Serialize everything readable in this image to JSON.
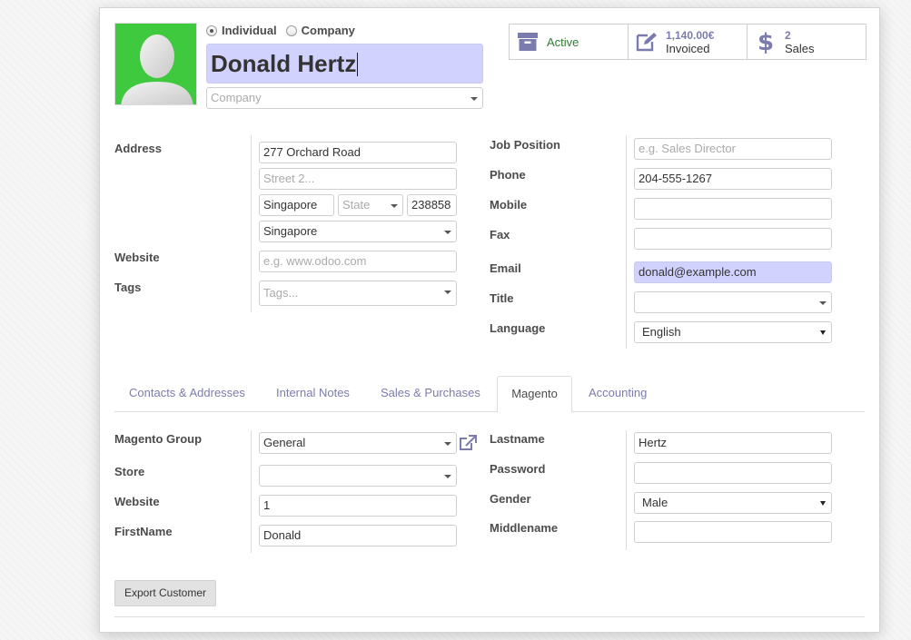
{
  "partner_type": {
    "individual": "Individual",
    "company": "Company"
  },
  "header": {
    "name": "Donald Hertz",
    "company_placeholder": "Company"
  },
  "stats": [
    {
      "label": "Active"
    },
    {
      "value": "1,140.00€",
      "label": "Invoiced"
    },
    {
      "value": "2",
      "label": "Sales"
    }
  ],
  "address": {
    "label": "Address",
    "street": "277 Orchard Road",
    "street2_placeholder": "Street 2...",
    "city": "Singapore",
    "state_placeholder": "State",
    "zip": "238858",
    "country": "Singapore"
  },
  "website": {
    "label": "Website",
    "placeholder": "e.g. www.odoo.com"
  },
  "tags": {
    "label": "Tags",
    "placeholder": "Tags..."
  },
  "right_fields": {
    "job_position": {
      "label": "Job Position",
      "placeholder": "e.g. Sales Director"
    },
    "phone": {
      "label": "Phone",
      "value": "204-555-1267"
    },
    "mobile": {
      "label": "Mobile",
      "value": ""
    },
    "fax": {
      "label": "Fax",
      "value": ""
    },
    "email": {
      "label": "Email",
      "value": "donald@example.com"
    },
    "title": {
      "label": "Title",
      "value": ""
    },
    "language": {
      "label": "Language",
      "value": "English"
    }
  },
  "tabs": [
    "Contacts & Addresses",
    "Internal Notes",
    "Sales & Purchases",
    "Magento",
    "Accounting"
  ],
  "magento": {
    "group": {
      "label": "Magento Group",
      "value": "General"
    },
    "store": {
      "label": "Store",
      "value": ""
    },
    "website": {
      "label": "Website",
      "value": "1"
    },
    "firstname": {
      "label": "FirstName",
      "value": "Donald"
    },
    "lastname": {
      "label": "Lastname",
      "value": "Hertz"
    },
    "password": {
      "label": "Password",
      "value": ""
    },
    "gender": {
      "label": "Gender",
      "value": "Male"
    },
    "middlename": {
      "label": "Middlename",
      "value": ""
    }
  },
  "buttons": {
    "export": "Export Customer"
  },
  "colors": {
    "accent": "#7c7bad",
    "avatar_bg": "#3ec93e",
    "highlight": "#d2d2ff",
    "active_green": "#2f7d32"
  }
}
